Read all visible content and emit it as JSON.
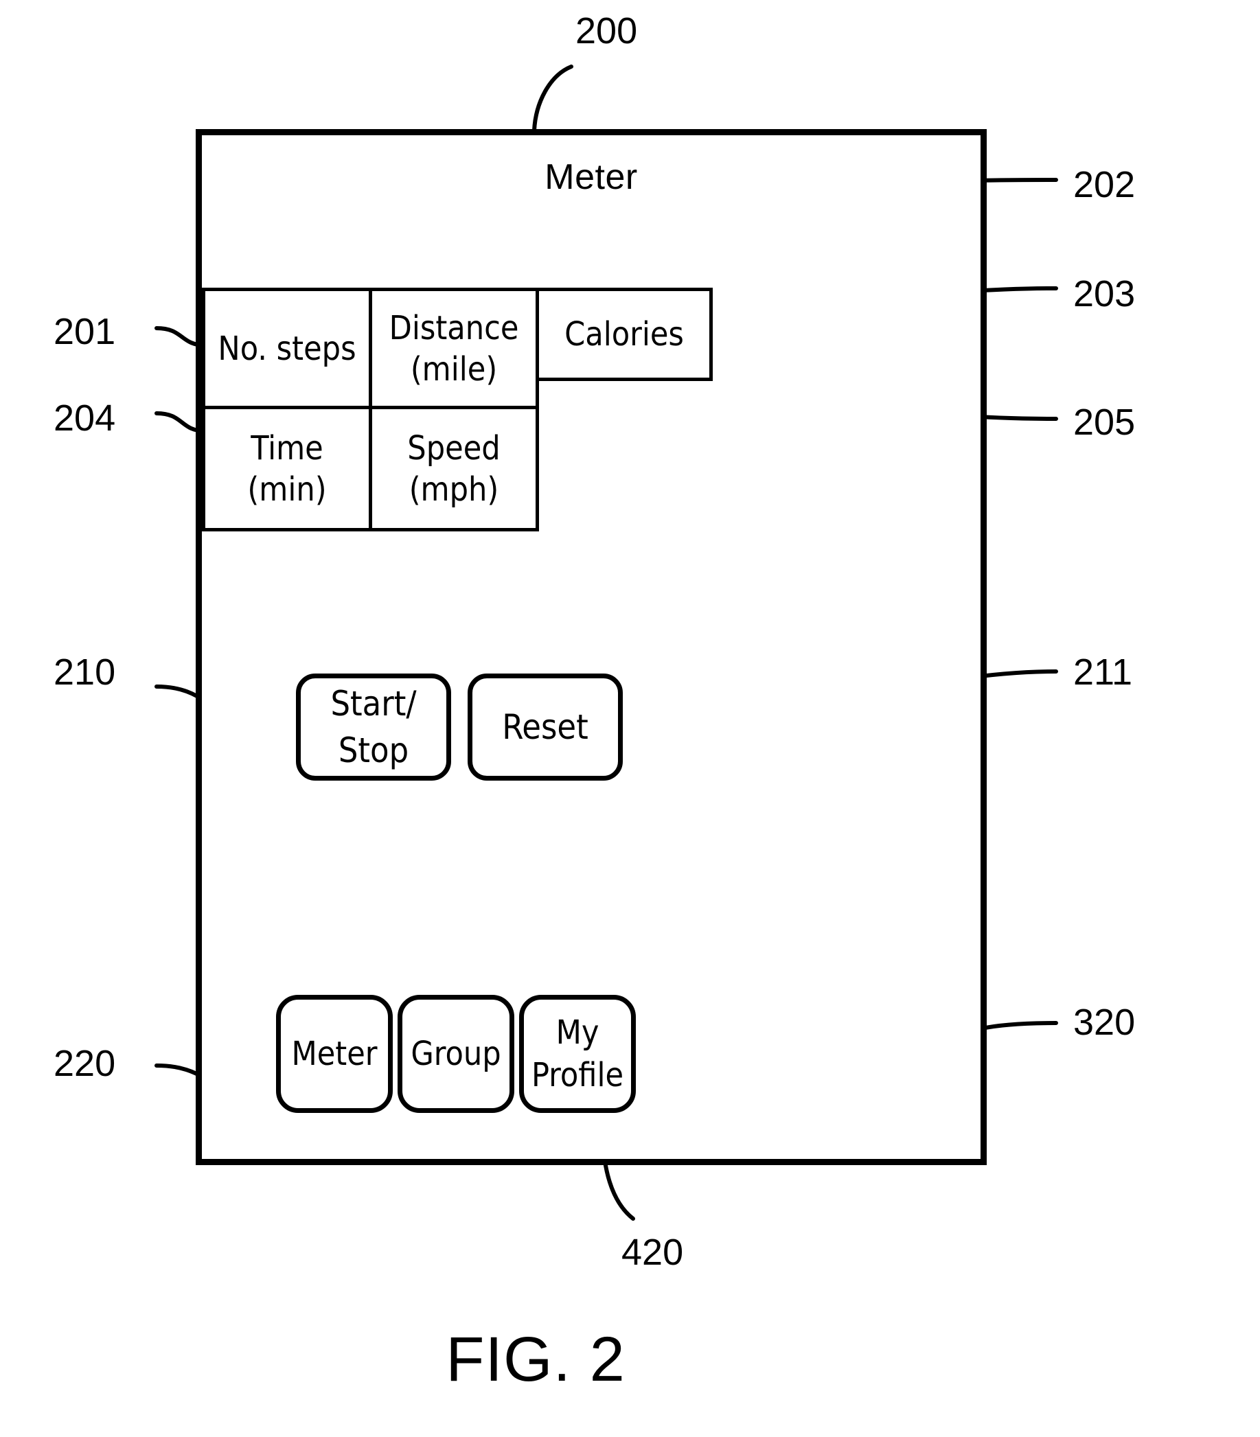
{
  "figure": {
    "caption": "FIG. 2",
    "device_label": "200"
  },
  "screen": {
    "title": "Meter"
  },
  "metrics_table": {
    "cells": [
      {
        "id": "no-steps",
        "line1": "No. steps",
        "line2": ""
      },
      {
        "id": "distance",
        "line1": "Distance",
        "line2": "(mile)"
      },
      {
        "id": "calories",
        "line1": "Calories",
        "line2": ""
      },
      {
        "id": "time",
        "line1": "Time",
        "line2": "(min)"
      },
      {
        "id": "speed",
        "line1": "Speed",
        "line2": "(mph)"
      }
    ]
  },
  "actions": {
    "start_stop_line1": "Start/",
    "start_stop_line2": "Stop",
    "reset": "Reset"
  },
  "navigation": {
    "meter": "Meter",
    "group": "Group",
    "profile_line1": "My",
    "profile_line2": "Profile"
  },
  "reference_numerals": {
    "device": "200",
    "no_steps": "201",
    "distance": "202",
    "calories": "203",
    "time": "204",
    "speed": "205",
    "start_stop": "210",
    "reset": "211",
    "meter_tab": "220",
    "profile_tab": "320",
    "group_tab": "420"
  },
  "colors": {
    "stroke": "#000000",
    "background": "#ffffff"
  }
}
